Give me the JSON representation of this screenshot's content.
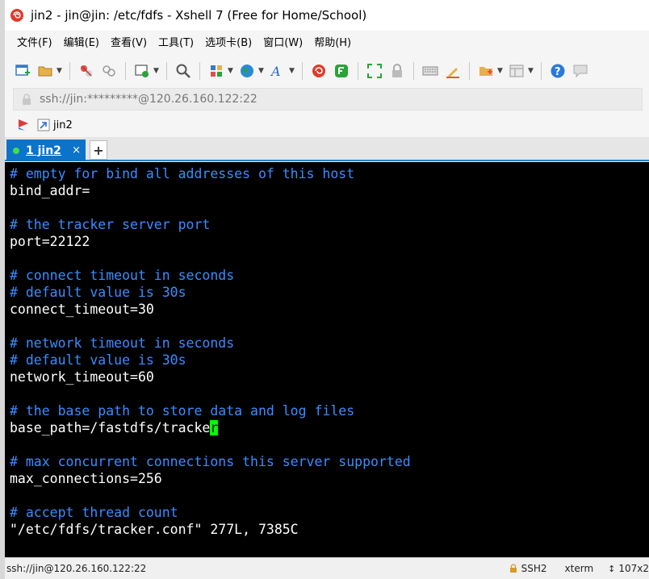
{
  "window": {
    "title": "jin2 - jin@jin: /etc/fdfs - Xshell 7 (Free for Home/School)"
  },
  "menu": [
    {
      "label": "文件(F)"
    },
    {
      "label": "编辑(E)"
    },
    {
      "label": "查看(V)"
    },
    {
      "label": "工具(T)"
    },
    {
      "label": "选项卡(B)"
    },
    {
      "label": "窗口(W)"
    },
    {
      "label": "帮助(H)"
    }
  ],
  "address": {
    "value": "ssh://jin:*********@120.26.160.122:22"
  },
  "session": {
    "label": "jin2"
  },
  "tab": {
    "label": "1 jin2",
    "close": "×",
    "new": "+"
  },
  "terminal": {
    "lines": [
      {
        "text": "# empty for bind all addresses of this host",
        "type": "comment"
      },
      {
        "text": "bind_addr=",
        "type": "normal"
      },
      {
        "text": "",
        "type": "normal"
      },
      {
        "text": "# the tracker server port",
        "type": "comment"
      },
      {
        "text": "port=22122",
        "type": "normal"
      },
      {
        "text": "",
        "type": "normal"
      },
      {
        "text": "# connect timeout in seconds",
        "type": "comment"
      },
      {
        "text": "# default value is 30s",
        "type": "comment"
      },
      {
        "text": "connect_timeout=30",
        "type": "normal"
      },
      {
        "text": "",
        "type": "normal"
      },
      {
        "text": "# network timeout in seconds",
        "type": "comment"
      },
      {
        "text": "# default value is 30s",
        "type": "comment"
      },
      {
        "text": "network_timeout=60",
        "type": "normal"
      },
      {
        "text": "",
        "type": "normal"
      },
      {
        "text": "# the base path to store data and log files",
        "type": "comment"
      },
      {
        "text": "base_path=/fastdfs/tracke",
        "cursor_char": "r",
        "type": "normal"
      },
      {
        "text": "",
        "type": "normal"
      },
      {
        "text": "# max concurrent connections this server supported",
        "type": "comment"
      },
      {
        "text": "max_connections=256",
        "type": "normal"
      },
      {
        "text": "",
        "type": "normal"
      },
      {
        "text": "# accept thread count",
        "type": "comment"
      },
      {
        "text": "\"/etc/fdfs/tracker.conf\" 277L, 7385C",
        "type": "normal"
      }
    ]
  },
  "status": {
    "connection": "ssh://jin@120.26.160.122:22",
    "protocol": "SSH2",
    "terminal_type": "xterm",
    "size": "107x2"
  },
  "colors": {
    "terminal_bg": "#000000",
    "terminal_fg": "#ffffff",
    "comment": "#3c8cff",
    "cursor": "#00ff00",
    "tab_active": "#0d73c8"
  }
}
